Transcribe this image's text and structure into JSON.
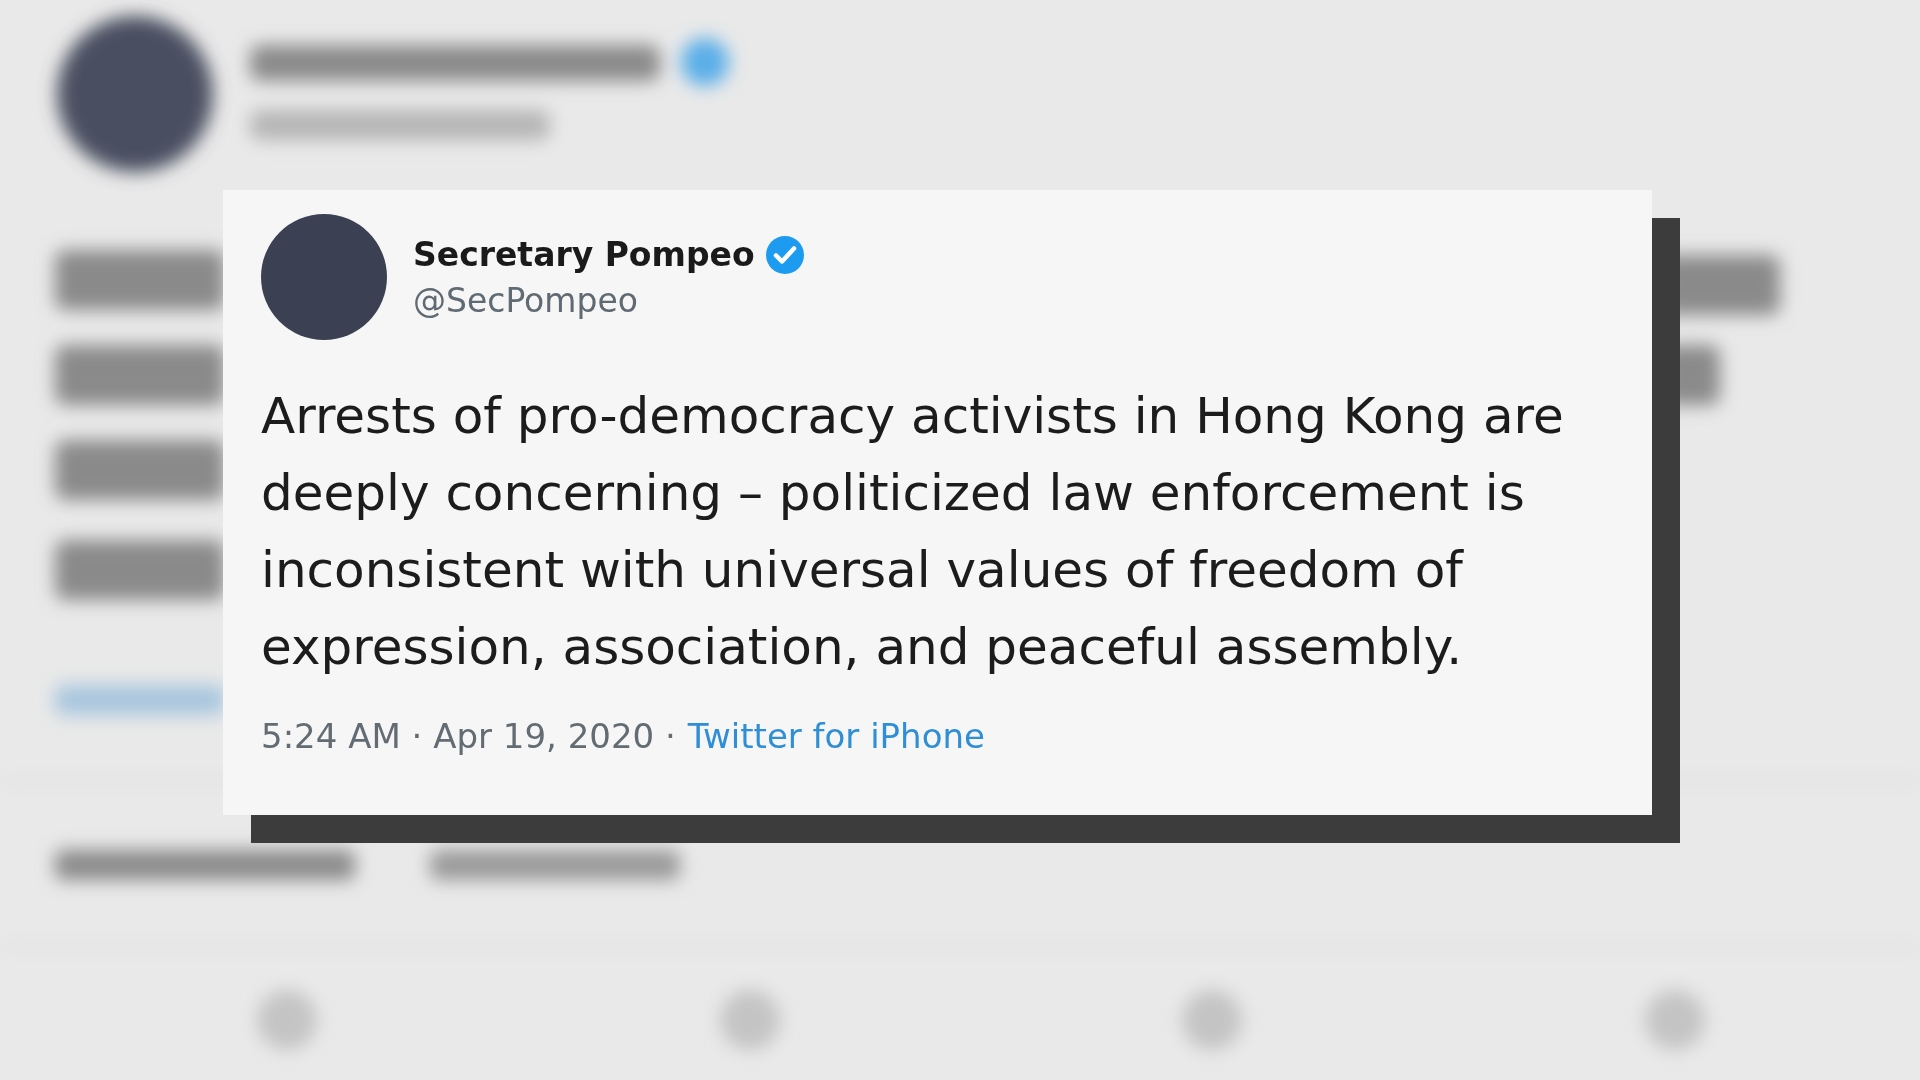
{
  "tweet": {
    "author": {
      "name": "Secretary Pompeo",
      "handle": "@SecPompeo",
      "verified": true
    },
    "text": "Arrests of pro-democracy activists in Hong Kong are deeply concerning – politicized law enforcement is inconsistent with universal values of freedom of expression, association, and peaceful assembly.",
    "timestamp": "5:24 AM · Apr 19, 2020 ·",
    "source": "Twitter for iPhone"
  }
}
